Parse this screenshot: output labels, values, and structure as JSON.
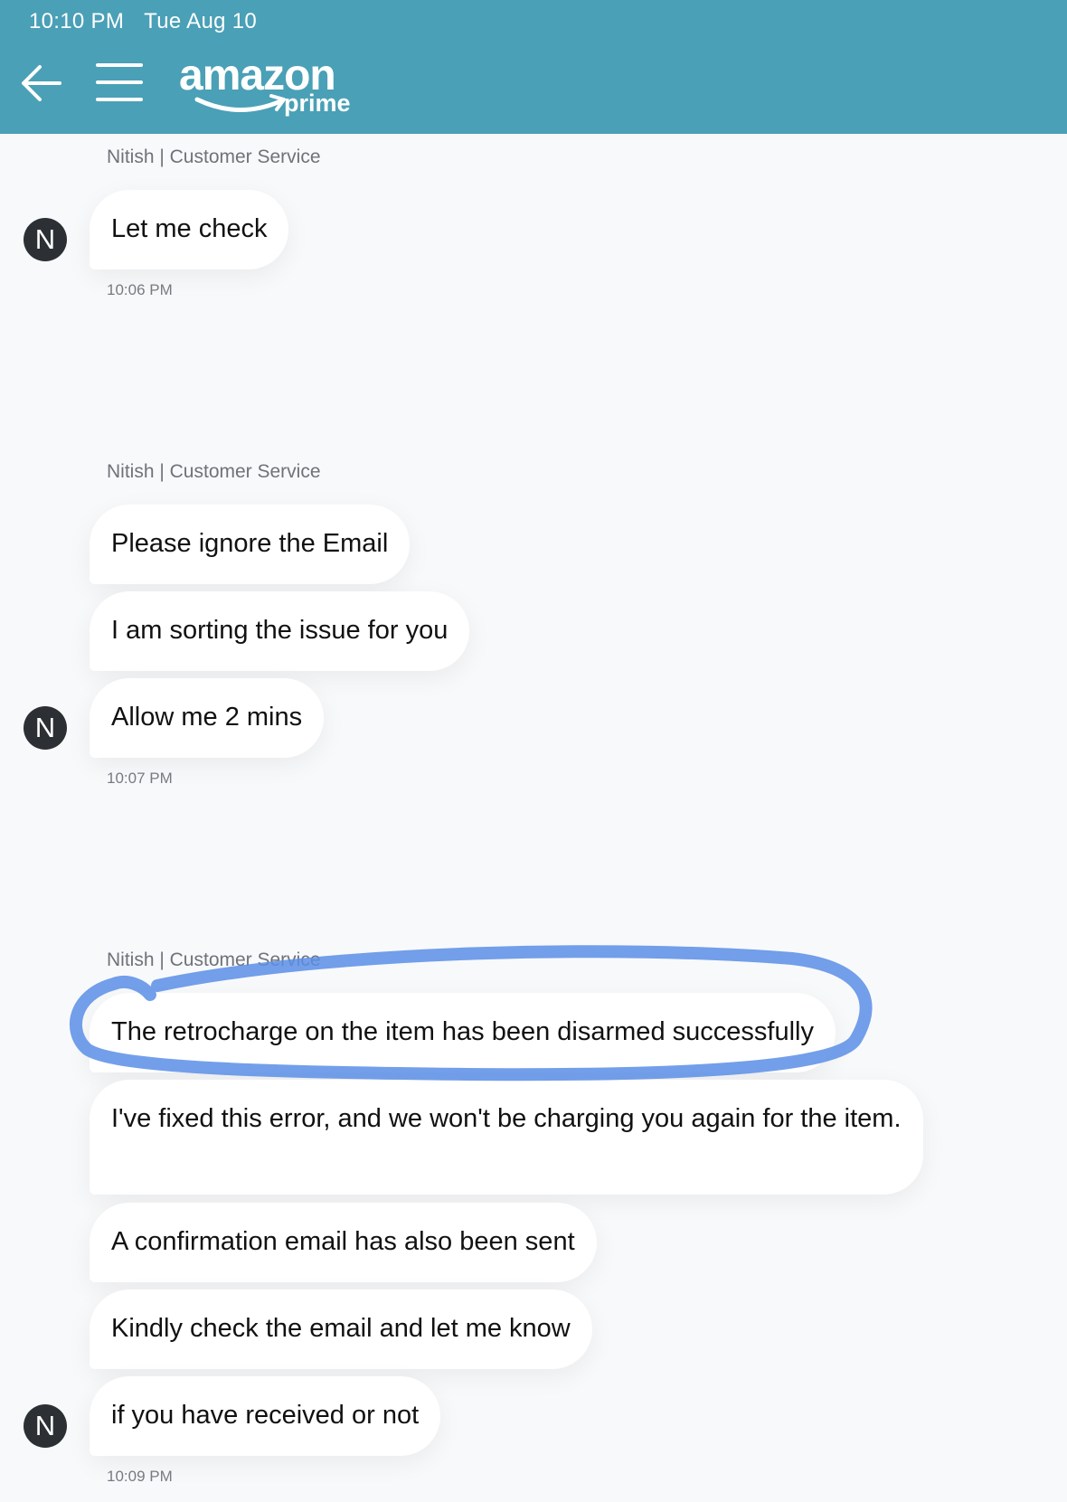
{
  "status_bar": {
    "time": "10:10 PM",
    "date": "Tue Aug 10"
  },
  "header": {
    "back_icon": "arrow-left-icon",
    "menu_icon": "hamburger-menu-icon",
    "logo_word": "amazon",
    "logo_sub": "prime",
    "color": "#4aa0b6"
  },
  "groups": [
    {
      "sender": "Nitish | Customer Service",
      "avatar": "N",
      "time": "10:06 PM",
      "messages": [
        "Let me check"
      ]
    },
    {
      "sender": "Nitish | Customer Service",
      "avatar": "N",
      "time": "10:07 PM",
      "messages": [
        "Please ignore the Email",
        "I am sorting the issue for you",
        "Allow me 2 mins"
      ]
    },
    {
      "sender": "Nitish | Customer Service",
      "avatar": "N",
      "time": "10:09 PM",
      "messages": [
        "The retrocharge on the item has been disarmed successfully",
        "I've fixed this error, and we won't be charging you again for the item.",
        "A confirmation email has also been sent",
        "Kindly check the email and let me know",
        "if you have received or not"
      ]
    }
  ],
  "annotation": {
    "highlight_color": "#5b8ee6"
  }
}
